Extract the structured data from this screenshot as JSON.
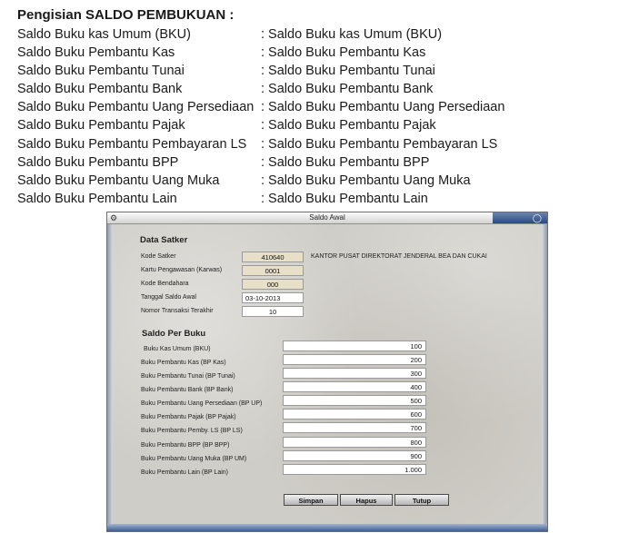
{
  "doc": {
    "title": "Pengisian SALDO PEMBUKUAN :",
    "rows": [
      {
        "label": "Saldo Buku kas Umum (BKU)",
        "value": ": Saldo Buku kas Umum (BKU)"
      },
      {
        "label": "Saldo Buku Pembantu Kas",
        "value": ": Saldo Buku Pembantu Kas"
      },
      {
        "label": "Saldo Buku Pembantu Tunai",
        "value": ": Saldo Buku Pembantu Tunai"
      },
      {
        "label": "Saldo Buku Pembantu Bank",
        "value": ": Saldo Buku Pembantu Bank"
      },
      {
        "label": "Saldo Buku Pembantu Uang Persediaan",
        "value": ": Saldo Buku Pembantu Uang Persediaan"
      },
      {
        "label": "Saldo Buku Pembantu Pajak",
        "value": ": Saldo Buku Pembantu Pajak"
      },
      {
        "label": "Saldo Buku Pembantu Pembayaran LS",
        "value": ": Saldo Buku Pembantu Pembayaran LS"
      },
      {
        "label": "Saldo Buku Pembantu BPP",
        "value": ": Saldo Buku Pembantu BPP"
      },
      {
        "label": "Saldo Buku Pembantu Uang Muka",
        "value": ": Saldo Buku Pembantu Uang Muka"
      },
      {
        "label": "Saldo Buku Pembantu Lain",
        "value": ": Saldo Buku Pembantu Lain"
      }
    ]
  },
  "window": {
    "title": "Saldo Awal",
    "system_icon": "app-icon",
    "controls_icon": "close-icon",
    "satker": {
      "heading": "Data Satker",
      "kode_satker_label": "Kode Satker",
      "kode_satker": "410640",
      "nama_satker": "KANTOR PUSAT DIREKTORAT JENDERAL BEA DAN CUKAI",
      "kartu_label": "Kartu Pengawasan (Karwas)",
      "kartu": "0001",
      "bendahara_label": "Kode Bendahara",
      "bendahara": "000",
      "tanggal_label": "Tanggal Saldo Awal",
      "tanggal": "03-10-2013",
      "nomor_label": "Nomor Transaksi Terakhir",
      "nomor": "10"
    },
    "saldo": {
      "heading": "Saldo Per Buku",
      "items": [
        {
          "label": "Buku Kas Umum (BKU)",
          "value": "100"
        },
        {
          "label": "Buku Pembantu Kas (BP Kas)",
          "value": "200"
        },
        {
          "label": "Buku Pembantu Tunai (BP Tunai)",
          "value": "300"
        },
        {
          "label": "Buku Pembantu Bank (BP Bank)",
          "value": "400"
        },
        {
          "label": "Buku Pembantu Uang Persediaan (BP UP)",
          "value": "500"
        },
        {
          "label": "Buku Pembantu Pajak (BP Pajak)",
          "value": "600"
        },
        {
          "label": "Buku Pembantu Pemby. LS (BP LS)",
          "value": "700"
        },
        {
          "label": "Buku Pembantu BPP (BP BPP)",
          "value": "800"
        },
        {
          "label": "Buku Pembantu Uang Muka (BP UM)",
          "value": "900"
        },
        {
          "label": "Buku Pembantu Lain (BP Lain)",
          "value": "1.000"
        }
      ]
    },
    "buttons": {
      "simpan": "Simpan",
      "hapus": "Hapus",
      "tutup": "Tutup"
    }
  }
}
